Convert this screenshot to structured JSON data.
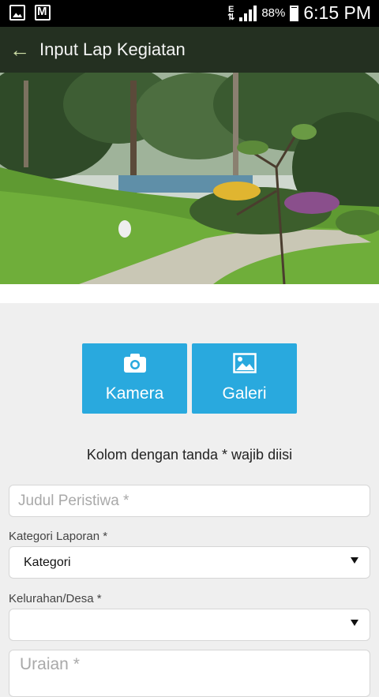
{
  "status_bar": {
    "network": "E",
    "battery": "88%",
    "time": "6:15 PM",
    "icons": [
      "gallery-notification-icon",
      "gmail-notification-icon",
      "signal-icon",
      "battery-icon"
    ]
  },
  "app_bar": {
    "title": "Input Lap Kegiatan",
    "back_icon": "arrow-left-icon",
    "colors": {
      "background": "#243021",
      "back_arrow": "#cfe0a8"
    }
  },
  "actions": {
    "camera_label": "Kamera",
    "camera_icon": "camera-icon",
    "gallery_label": "Galeri",
    "gallery_icon": "image-icon",
    "color": "#29a9de"
  },
  "form": {
    "required_note": "Kolom dengan tanda * wajib diisi",
    "judul_placeholder": "Judul Peristiwa *",
    "kategori_label": "Kategori Laporan *",
    "kategori_value": "Kategori",
    "kelurahan_label": "Kelurahan/Desa *",
    "kelurahan_value": "",
    "uraian_placeholder": "Uraian *"
  }
}
